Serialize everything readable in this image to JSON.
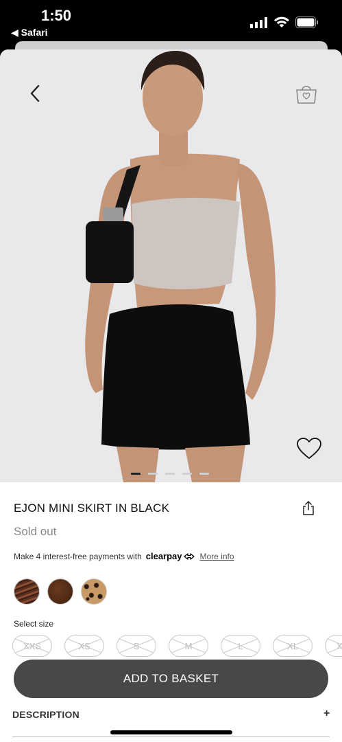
{
  "status_bar": {
    "time": "1:50",
    "back_app": "◀ Safari",
    "icons": [
      "signal-icon",
      "wifi-icon",
      "battery-icon"
    ]
  },
  "hero": {
    "back_icon": "chevron-left-icon",
    "bag_icon": "shopping-bag-icon",
    "wishlist_icon": "heart-icon",
    "carousel_pages": 5,
    "carousel_active": 1
  },
  "product": {
    "title": "EJON MINI SKIRT IN BLACK",
    "share_icon": "share-icon",
    "status": "Sold out",
    "payments_text": "Make 4 interest-free payments with",
    "provider": "clearpay",
    "more_info": "More info"
  },
  "colors": {
    "swatches": [
      "brown-zebra",
      "chocolate",
      "leopard"
    ]
  },
  "size": {
    "label": "Select size",
    "options": [
      "XXS",
      "XS",
      "S",
      "M",
      "L",
      "XL",
      "XXL"
    ]
  },
  "actions": {
    "add_to_basket": "ADD TO BASKET"
  },
  "accordion": {
    "description": "DESCRIPTION",
    "toggle": "+"
  }
}
